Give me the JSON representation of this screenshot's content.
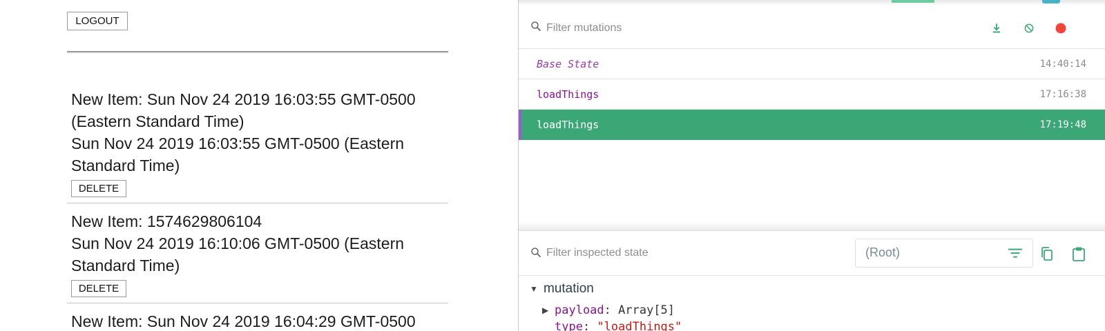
{
  "app": {
    "logout_label": "LOGOUT",
    "delete_label": "DELETE",
    "items": [
      {
        "title": "New Item: Sun Nov 24 2019 16:03:55 GMT-0500 (Eastern Standard Time)",
        "date": "Sun Nov 24 2019 16:03:55 GMT-0500 (Eastern Standard Time)"
      },
      {
        "title": "New Item: 1574629806104",
        "date": "Sun Nov 24 2019 16:10:06 GMT-0500 (Eastern Standard Time)"
      },
      {
        "title": "New Item: Sun Nov 24 2019 16:04:29 GMT-0500",
        "date": ""
      }
    ]
  },
  "devtools": {
    "filter_mutations_placeholder": "Filter mutations",
    "mutations": [
      {
        "name": "Base State",
        "time": "14:40:14"
      },
      {
        "name": "loadThings",
        "time": "17:16:38"
      },
      {
        "name": "loadThings",
        "time": "17:19:48"
      }
    ],
    "filter_state_placeholder": "Filter inspected state",
    "root_select_value": "(Root)",
    "tree": {
      "section": "mutation",
      "payload_key": "payload",
      "payload_value": "Array[5]",
      "type_key": "type",
      "type_value": "\"loadThings\""
    },
    "icons": {
      "export": "download-icon",
      "clear": "block-icon",
      "record": "record-icon",
      "copy": "copy-icon",
      "paste": "clipboard-icon",
      "filter": "filter-list-icon",
      "search": "search-icon"
    },
    "colors": {
      "accent": "#3ba776",
      "active_border": "#9b5cd0",
      "record": "#f2453d",
      "mutation_name": "#881391"
    }
  }
}
